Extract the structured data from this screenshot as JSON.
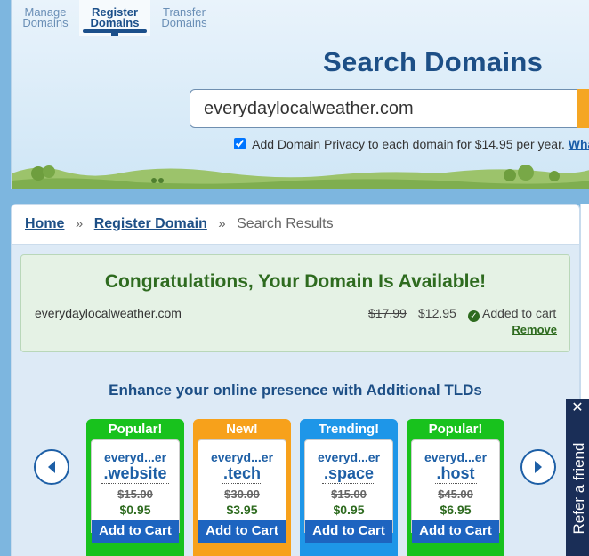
{
  "tabs": [
    {
      "line1": "Manage",
      "line2": "Domains"
    },
    {
      "line1": "Register",
      "line2": "Domains"
    },
    {
      "line1": "Transfer",
      "line2": "Domains"
    }
  ],
  "header": {
    "title": "Search Domains",
    "search_value": "everydaylocalweather.com",
    "privacy_text": "Add Domain Privacy to each domain for $14.95 per year.",
    "privacy_link": "Wha",
    "privacy_checked": true
  },
  "breadcrumb": {
    "home": "Home",
    "register": "Register Domain",
    "current": "Search Results",
    "separator": "»"
  },
  "result": {
    "heading": "Congratulations, Your Domain Is Available!",
    "domain": "everydaylocalweather.com",
    "old_price": "$17.99",
    "new_price": "$12.95",
    "status": "Added to cart",
    "remove": "Remove"
  },
  "enhance_heading": "Enhance your online presence with Additional TLDs",
  "tlds": [
    {
      "badge": "Popular!",
      "name": "everyd...er",
      "ext": ".website",
      "old": "$15.00",
      "new": "$0.95",
      "cart": "Add to Cart",
      "color": "#18c21d"
    },
    {
      "badge": "New!",
      "name": "everyd...er",
      "ext": ".tech",
      "old": "$30.00",
      "new": "$3.95",
      "cart": "Add to Cart",
      "color": "#f7a11b"
    },
    {
      "badge": "Trending!",
      "name": "everyd...er",
      "ext": ".space",
      "old": "$15.00",
      "new": "$0.95",
      "cart": "Add to Cart",
      "color": "#1e96e8"
    },
    {
      "badge": "Popular!",
      "name": "everyd...er",
      "ext": ".host",
      "old": "$45.00",
      "new": "$6.95",
      "cart": "Add to Cart",
      "color": "#18c21d"
    }
  ],
  "icons": {
    "prev": "chevron-left-icon",
    "next": "chevron-right-icon",
    "check": "check-circle-icon",
    "close": "close-icon"
  },
  "refer": {
    "label": "Refer a friend",
    "close": "✕"
  }
}
